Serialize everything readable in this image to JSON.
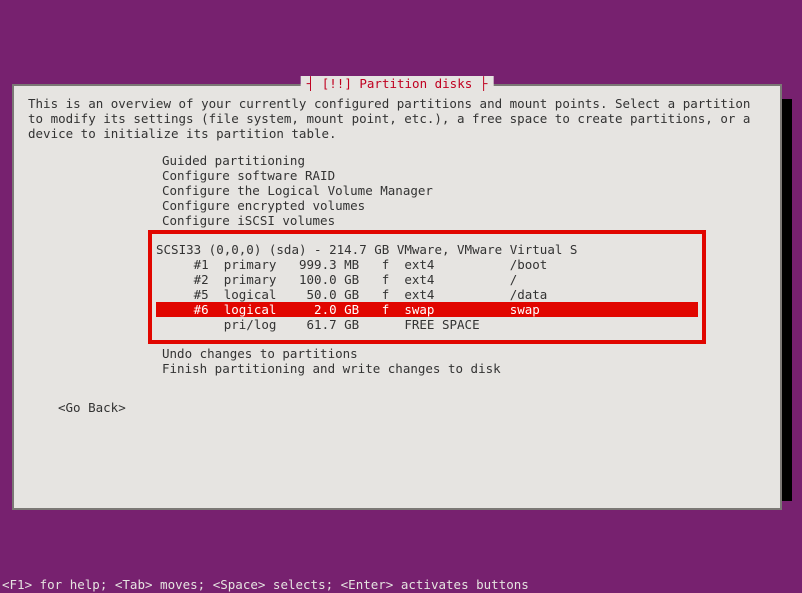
{
  "dialog": {
    "title": "[!!] Partition disks",
    "description": "This is an overview of your currently configured partitions and mount points. Select a partition to modify its settings (file system, mount point, etc.), a free space to create partitions, or a device to initialize its partition table.",
    "actions": {
      "guided": "Guided partitioning",
      "raid": "Configure software RAID",
      "lvm": "Configure the Logical Volume Manager",
      "enc": "Configure encrypted volumes",
      "iscsi": "Configure iSCSI volumes",
      "undo": "Undo changes to partitions",
      "finish": "Finish partitioning and write changes to disk",
      "go_back": "<Go Back>"
    },
    "disk": {
      "header": "SCSI33 (0,0,0) (sda) - 214.7 GB VMware, VMware Virtual S",
      "rows": [
        {
          "num": "#1",
          "type": "primary",
          "size": "999.3 MB",
          "flag": "f",
          "fs": "ext4",
          "mount": "/boot",
          "selected": false
        },
        {
          "num": "#2",
          "type": "primary",
          "size": "100.0 GB",
          "flag": "f",
          "fs": "ext4",
          "mount": "/",
          "selected": false
        },
        {
          "num": "#5",
          "type": "logical",
          "size": "50.0 GB",
          "flag": "f",
          "fs": "ext4",
          "mount": "/data",
          "selected": false
        },
        {
          "num": "#6",
          "type": "logical",
          "size": "2.0 GB",
          "flag": "f",
          "fs": "swap",
          "mount": "swap",
          "selected": true
        },
        {
          "num": "",
          "type": "pri/log",
          "size": "61.7 GB",
          "flag": "",
          "fs": "FREE SPACE",
          "mount": "",
          "selected": false
        }
      ]
    }
  },
  "help_bar": "<F1> for help; <Tab> moves; <Space> selects; <Enter> activates buttons"
}
